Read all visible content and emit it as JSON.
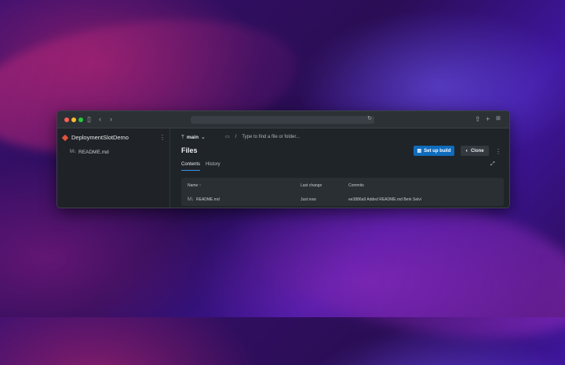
{
  "desktop": {
    "wallpaper": "purple macOS waves"
  },
  "browser": {
    "toolbar_icons": [
      "sidebar-icon",
      "back-icon",
      "forward-icon",
      "share-icon",
      "new-tab-icon",
      "tabs-overview-icon"
    ],
    "reload_icon": "reload-icon"
  },
  "sidebar": {
    "repo_name": "DeploymentSlotDemo",
    "files": [
      {
        "name": "README.md",
        "icon": "markdown-icon"
      }
    ]
  },
  "main": {
    "branch": "main",
    "path_separator": "/",
    "path_placeholder": "Type to find a file or folder...",
    "title": "Files",
    "setup_build_label": "Set up build",
    "clone_label": "Clone",
    "tabs": [
      {
        "label": "Contents",
        "active": true
      },
      {
        "label": "History",
        "active": false
      }
    ],
    "table": {
      "headers": {
        "name": "Name ↑",
        "last_change": "Last change",
        "commits": "Commits"
      },
      "rows": [
        {
          "name": "README.md",
          "last_change": "Just now",
          "commit": "ee3886a9 Added README.md Berk Selvi"
        }
      ]
    }
  },
  "colors": {
    "primary_button": "#0f6cbd",
    "active_tab_underline": "#3d8ee0",
    "repo_icon": "#e0533d"
  }
}
